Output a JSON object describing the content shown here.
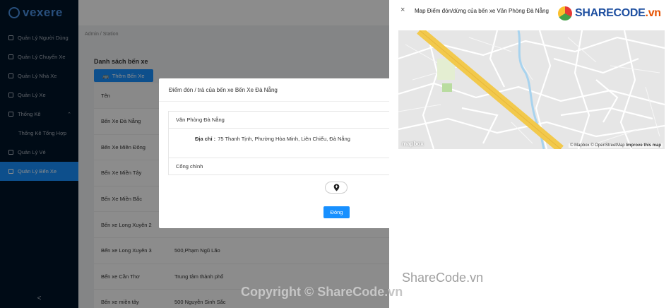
{
  "sidebar": {
    "logo": "vexere",
    "items": [
      {
        "label": "Quản Lý Người Dùng",
        "icon": "user-icon"
      },
      {
        "label": "Quản Lý Chuyến Xe",
        "icon": "car-icon"
      },
      {
        "label": "Quản Lý Nhà Xe",
        "icon": "bus-icon"
      },
      {
        "label": "Quản Lý Xe",
        "icon": "car-icon"
      },
      {
        "label": "Thống Kê",
        "icon": "chart-icon"
      },
      {
        "label": "Thống Kê Tổng Hợp",
        "icon": ""
      },
      {
        "label": "Quản Lý Vé",
        "icon": "ticket-icon"
      },
      {
        "label": "Quản Lý Bến Xe",
        "icon": "station-icon"
      }
    ],
    "collapse_icon": "<"
  },
  "breadcrumb": {
    "root": "Admin",
    "sep": "/",
    "current": "Station"
  },
  "page": {
    "title": "Danh sách bến xe",
    "add_button": "Thêm Bến Xe"
  },
  "table": {
    "header": "Tên",
    "rows": [
      {
        "name": "Bến Xe Đà Nẵng",
        "address": ""
      },
      {
        "name": "Bến Xe Miền Đông",
        "address": ""
      },
      {
        "name": "Bến Xe Miền Tây",
        "address": ""
      },
      {
        "name": "Bến Xe Miền Bắc",
        "address": ""
      },
      {
        "name": "Bến xe Long Xuyên 2",
        "address": ""
      },
      {
        "name": "Bến xe Long Xuyên 3",
        "address": "500,Phạm Ngũ Lão"
      },
      {
        "name": "Bến xe Cần Thơ",
        "address": "Trung tâm thành phố"
      },
      {
        "name": "Bến xe miền tây",
        "address": "500 Nguyễn Sinh Sắc"
      }
    ]
  },
  "modal": {
    "title": "Điểm đón / trả của bến xe Bến Xe Đà Nẵng",
    "station_name": "Văn Phòng Đà Nẵng",
    "address_label": "Địa chỉ :",
    "address_value": "75 Thanh Tịnh, Phường Hòa Minh, Liên Chiểu, Đà Nẵng",
    "gate": "Cổng chính",
    "close_button": "Đóng"
  },
  "drawer": {
    "close_icon": "×",
    "title": "Map Điểm đón/dừng của bến xe Văn Phòng Đà Nẵng",
    "map": {
      "logo": "mapbox",
      "attribution_1": "© Mapbox © OpenStreetMap",
      "attribution_2": "Improve this map"
    }
  },
  "watermarks": {
    "badge_main": "SHARECODE",
    "badge_suffix": ".vn",
    "text_1": "ShareCode.vn",
    "text_2": "Copyright © ShareCode.vn"
  },
  "colors": {
    "primary": "#1890ff",
    "sidebar": "#001529",
    "road": "#f2c94c"
  }
}
